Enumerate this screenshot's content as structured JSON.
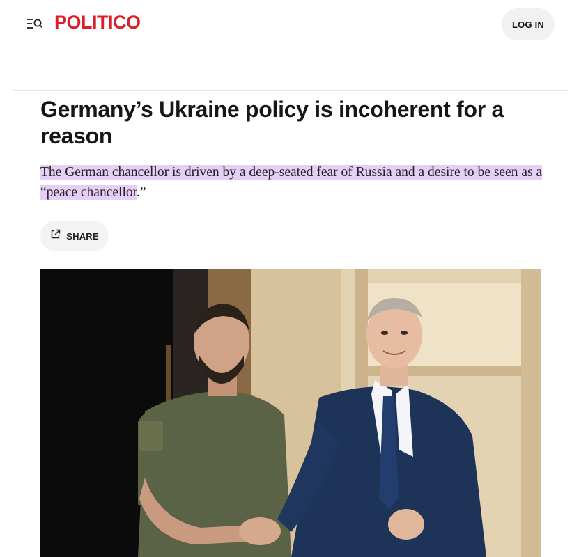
{
  "header": {
    "logo": "POLITICO",
    "login_label": "LOG IN"
  },
  "icons": {
    "menu_search": "menu-search-icon",
    "share": "share-icon"
  },
  "article": {
    "headline": "Germany’s Ukraine policy is incoherent for a reason",
    "dek_highlighted": "The German chancellor is driven by a deep-seated fear of Russia and a desire to be seen as a “peace chancellor",
    "dek_tail": ".”",
    "share_label": "SHARE"
  },
  "colors": {
    "brand": "#dc1f26",
    "highlight": "#e6cff7",
    "button_bg": "#f1f1f1"
  }
}
